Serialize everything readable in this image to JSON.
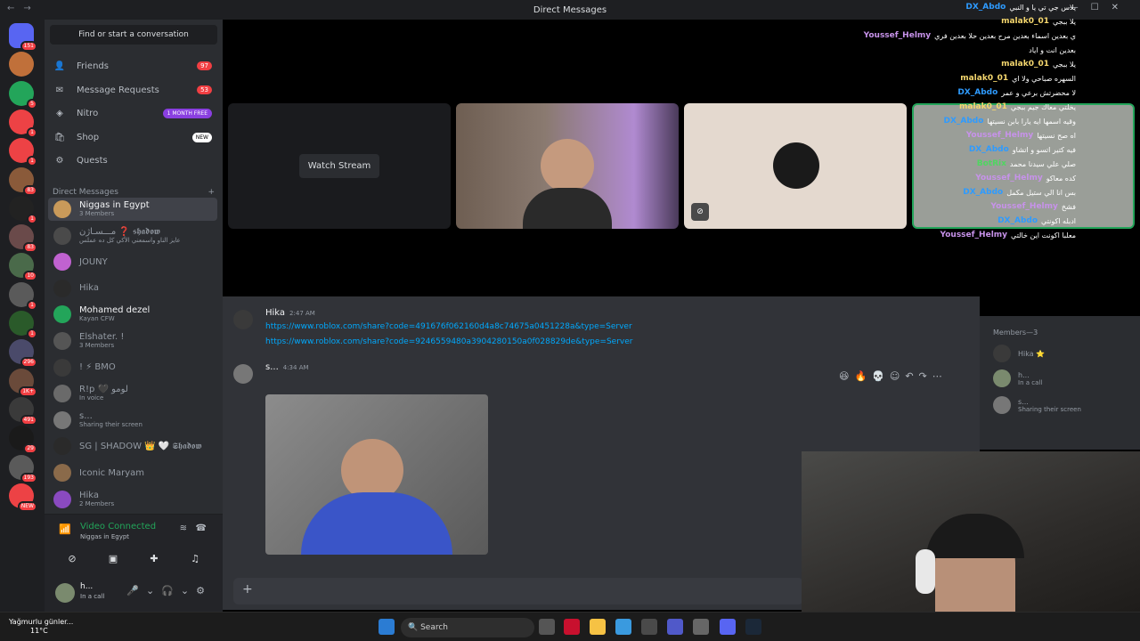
{
  "title": "Direct Messages",
  "sidebar": {
    "search_label": "Find or start a conversation",
    "nav": [
      {
        "label": "Friends",
        "badge": "97"
      },
      {
        "label": "Message Requests",
        "badge": "53"
      },
      {
        "label": "Nitro",
        "badge": "1 MONTH FREE"
      },
      {
        "label": "Shop",
        "badge": "NEW"
      },
      {
        "label": "Quests",
        "badge": ""
      }
    ],
    "dm_header": "Direct Messages",
    "dms": [
      {
        "name": "Niggas in Egypt",
        "sub": "3 Members"
      },
      {
        "name": "مـــسـاژن ❓ 𝖘𝖍𝖆𝖉𝖔𝖜",
        "sub": "عايز الناو واسمعني الأكي كل ده عملس"
      },
      {
        "name": "JOUNY",
        "sub": ""
      },
      {
        "name": "Hika",
        "sub": ""
      },
      {
        "name": "Mohamed dezel",
        "sub": "Kayan CFW"
      },
      {
        "name": "Elshater. !",
        "sub": "3 Members"
      },
      {
        "name": "! ⚡ BMO",
        "sub": ""
      },
      {
        "name": "R!p 🖤 لومو",
        "sub": "In voice"
      },
      {
        "name": "s...",
        "sub": "Sharing their screen"
      },
      {
        "name": "SG | SHADOW 👑 🤍 𝕾𝖍𝖆𝖉𝖔𝖜",
        "sub": ""
      },
      {
        "name": "Iconic Maryam",
        "sub": ""
      },
      {
        "name": "Hika",
        "sub": "2 Members"
      }
    ],
    "voice": {
      "status": "Video Connected",
      "channel": "Niggas in Egypt"
    },
    "user": {
      "name": "h...",
      "status": "In a call"
    }
  },
  "servers": [
    {
      "badge": "151",
      "color": "#5865f2"
    },
    {
      "badge": "",
      "color": "#c0703a"
    },
    {
      "badge": "5",
      "color": "#23a55a"
    },
    {
      "badge": "1",
      "color": "#ed4245"
    },
    {
      "badge": "1",
      "color": "#ed4245"
    },
    {
      "badge": "83",
      "color": "#8a5a3a"
    },
    {
      "badge": "1",
      "color": "#222222"
    },
    {
      "badge": "83",
      "color": "#6a4a4a"
    },
    {
      "badge": "10",
      "color": "#4a6a4a"
    },
    {
      "badge": "1",
      "color": "#5a5a5a"
    },
    {
      "badge": "1",
      "color": "#2a5a2a"
    },
    {
      "badge": "296",
      "color": "#4a4a6a"
    },
    {
      "badge": "1K+",
      "color": "#6a4a3a"
    },
    {
      "badge": "491",
      "color": "#3a3a3a"
    },
    {
      "badge": "29",
      "color": "#1a1a1a"
    },
    {
      "badge": "193",
      "color": "#5a5a5a"
    },
    {
      "badge": "NEW",
      "color": "#ed4245"
    }
  ],
  "stage": {
    "watch_stream": "Watch Stream"
  },
  "chat": {
    "messages": [
      {
        "author": "Hika",
        "time": "2:47 AM",
        "links": [
          "https://www.roblox.com/share?code=491676f062160d4a8c74675a0451228a&type=Server",
          "https://www.roblox.com/share?code=9246559480a3904280150a0f028829de&type=Server"
        ]
      },
      {
        "author": "s...",
        "time": "4:34 AM"
      }
    ],
    "composer_icon": "+"
  },
  "members": {
    "header": "Members—3",
    "list": [
      {
        "name": "Hika ⭐",
        "status": ""
      },
      {
        "name": "h...",
        "status": "In a call"
      },
      {
        "name": "s...",
        "status": "Sharing their screen"
      }
    ]
  },
  "overlay_chat": [
    {
      "user": "DX_Abdo",
      "text": "يلاس جي تي يا و النبي",
      "color": "#2e9bff"
    },
    {
      "user": "malak0_01",
      "text": "يلا ببجي",
      "color": "#f5d76e"
    },
    {
      "user": "Youssef_Helmy",
      "text": "ي بعدين اسماء بعدين مرح بعدين حلا بعدين فري",
      "color": "#c792ea"
    },
    {
      "user": "",
      "text": "بعدين انت و اياد",
      "color": "#ffffff"
    },
    {
      "user": "malak0_01",
      "text": "يلا ببجي",
      "color": "#f5d76e"
    },
    {
      "user": "malak0_01",
      "text": "السهره صباحي ولا اي",
      "color": "#f5d76e"
    },
    {
      "user": "DX_Abdo",
      "text": "لا محضرتش برعي و عمر",
      "color": "#2e9bff"
    },
    {
      "user": "malak0_01",
      "text": "يخلتي معاك جيم ببجي",
      "color": "#f5d76e"
    },
    {
      "user": "DX_Abdo",
      "text": "وقيه اسمها ايه يارا بابن نسيتها",
      "color": "#2e9bff"
    },
    {
      "user": "Youssef_Helmy",
      "text": "اه صح نسيتها",
      "color": "#c792ea"
    },
    {
      "user": "DX_Abdo",
      "text": "فيه كتير اتسو و اتشاو",
      "color": "#2e9bff"
    },
    {
      "user": "BotRix",
      "text": "صلي علي سيدنا محمد",
      "color": "#4fd660"
    },
    {
      "user": "Youssef_Helmy",
      "text": "كده معاكو",
      "color": "#c792ea"
    },
    {
      "user": "DX_Abdo",
      "text": "بس انا الي ستيل مكمل",
      "color": "#2e9bff"
    },
    {
      "user": "Youssef_Helmy",
      "text": "فشخ",
      "color": "#c792ea"
    },
    {
      "user": "DX_Abdo",
      "text": "ادبله اكونتي",
      "color": "#2e9bff"
    },
    {
      "user": "Youssef_Helmy",
      "text": "معلبا اكونت اين خالتي",
      "color": "#c792ea"
    }
  ],
  "taskbar": {
    "weather_title": "Yağmurlu günler...",
    "weather_temp": "11°C",
    "search_label": "Search"
  },
  "colors": {
    "discord_bg": "#313338",
    "sidebar_bg": "#2b2d31",
    "server_bg": "#1e1f22",
    "link": "#00a8fc",
    "voice_green": "#23a55a"
  }
}
